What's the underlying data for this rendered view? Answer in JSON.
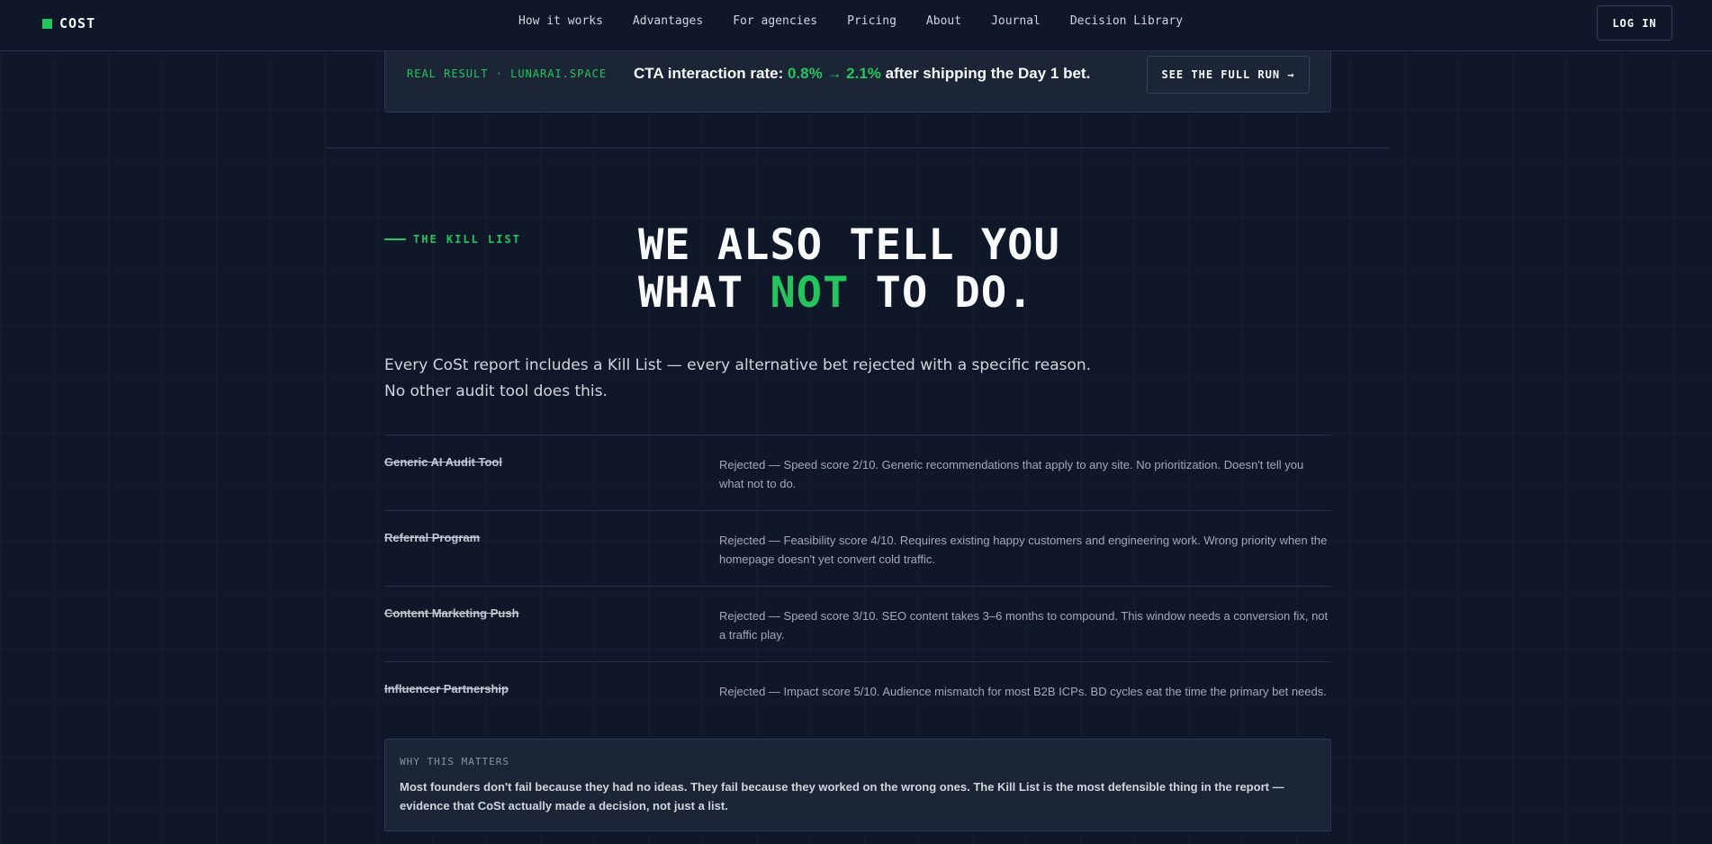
{
  "nav": {
    "logo": "COST",
    "links": [
      "How it works",
      "Advantages",
      "For agencies",
      "Pricing",
      "About",
      "Journal",
      "Decision Library"
    ],
    "login_label": "LOG IN"
  },
  "banner": {
    "label": "REAL RESULT · LUNARAI.SPACE",
    "text_prefix": "CTA interaction rate: ",
    "text_highlight": "0.8% → 2.1%",
    "text_suffix": " after shipping the Day 1 bet.",
    "button_label": "SEE THE FULL RUN →"
  },
  "kill_section": {
    "eyebrow": "THE KILL LIST",
    "headline_line1": "WE ALSO TELL YOU",
    "headline_line2_pre": "WHAT ",
    "headline_line2_highlight": "NOT",
    "headline_line2_post": " TO DO.",
    "intro": "Every CoSt report includes a Kill List — every alternative bet rejected with a specific reason. No other audit tool does this.",
    "items": [
      {
        "name": "Generic AI Audit Tool",
        "reason": "Rejected — Speed score 2/10. Generic recommendations that apply to any site. No prioritization. Doesn't tell you what not to do."
      },
      {
        "name": "Referral Program",
        "reason": "Rejected — Feasibility score 4/10. Requires existing happy customers and engineering work. Wrong priority when the homepage doesn't yet convert cold traffic."
      },
      {
        "name": "Content Marketing Push",
        "reason": "Rejected — Speed score 3/10. SEO content takes 3–6 months to compound. This window needs a conversion fix, not a traffic play."
      },
      {
        "name": "Influencer Partnership",
        "reason": "Rejected — Impact score 5/10. Audience mismatch for most B2B ICPs. BD cycles eat the time the primary bet needs."
      }
    ],
    "why_label": "WHY THIS MATTERS",
    "why_text": "Most founders don't fail because they had no ideas. They fail because they worked on the wrong ones. The Kill List is the most defensible thing in the report — evidence that CoSt actually made a decision, not just a list."
  },
  "colors": {
    "background": "#0f1729",
    "accent": "#22c55e",
    "panel": "#1c2536"
  }
}
